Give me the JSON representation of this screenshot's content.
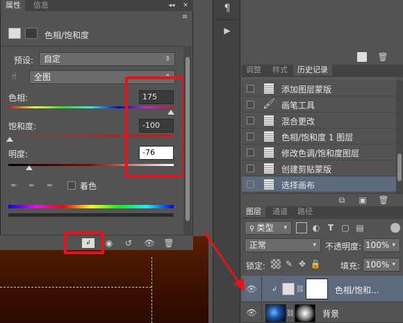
{
  "props_panel": {
    "tab_props": "属性",
    "tab_info": "信息",
    "header_title": "色相/饱和度",
    "preset_label": "预设:",
    "preset_value": "自定",
    "range_value": "全图",
    "hue_label": "色相:",
    "hue_value": "175",
    "sat_label": "饱和度:",
    "sat_value": "-100",
    "light_label": "明度:",
    "light_value": "-76",
    "colorize_label": "着色"
  },
  "history_panel": {
    "tab_adjust": "调整",
    "tab_styles": "样式",
    "tab_history": "历史记录",
    "items": [
      {
        "label": "添加图层蒙版"
      },
      {
        "label": "画笔工具"
      },
      {
        "label": "混合更改"
      },
      {
        "label": "色相/饱和度 1 图层"
      },
      {
        "label": "修改色调/饱和度图层"
      },
      {
        "label": "创建剪贴蒙版"
      },
      {
        "label": "选择画布"
      }
    ]
  },
  "layers_panel": {
    "tab_layers": "图层",
    "tab_channels": "通道",
    "tab_paths": "路径",
    "filter_kind": "类型",
    "blend_mode": "正常",
    "opacity_label": "不透明度:",
    "opacity_value": "100%",
    "lock_label": "锁定:",
    "fill_label": "填充:",
    "fill_value": "100%",
    "layer1_name": "色相/饱和...",
    "layer2_name": "背景"
  },
  "colors": {
    "highlight_red": "#e3141b",
    "selected_row": "#5d6a7e"
  }
}
